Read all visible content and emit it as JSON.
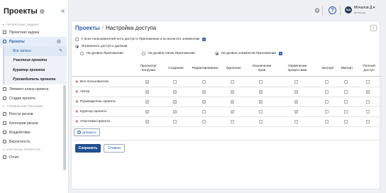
{
  "sidebar": {
    "app_title": "Проекты",
    "sections": [
      {
        "label": "Проектные задачи"
      },
      {
        "label": "Управление рисками"
      },
      {
        "label": "Контроль проектов"
      }
    ],
    "items": {
      "project_task": "Проектная задача",
      "projects": "Проекты",
      "all_records": "Все записи",
      "participant": "Участник проекта",
      "curator": "Куратор проекта",
      "manager": "Руководитель проекта",
      "plan_element": "Элемент плана проекта",
      "stages": "Стадии проекта",
      "risk_registers": "Реестр рисков",
      "risk_categories": "Категории рисков",
      "impact": "Воздействие",
      "probability": "Вероятность",
      "report": "Отчет"
    }
  },
  "topbar": {
    "help": "?",
    "avatar_initials": "МД",
    "user_name": "Мочалов Д",
    "user_sub": "demo-prj"
  },
  "page": {
    "crumb_link": "Проекты",
    "crumb_sep": "/",
    "crumb_current": "Настройка доступа",
    "pin": "⇧",
    "opt_all_users": "У всех пользователей есть доступ к Приложению и ко всем его элементам",
    "opt_restrict": "Ограничить доступ к данным",
    "level_app": "На уровне Приложения",
    "level_folders": "На уровне папок Приложения",
    "level_elements": "На уровне элементов Приложения"
  },
  "table": {
    "headers": [
      "Просмотр/\nЗагрузка",
      "Создание",
      "Редактирование",
      "Удаление",
      "Назначение\nправ",
      "Управление\nпроцессами",
      "Экспорт",
      "Импорт",
      "Полный\nдоступ"
    ],
    "rows": [
      {
        "label": "Все пользователи",
        "checks": [
          true,
          false,
          false,
          false,
          false,
          false,
          false,
          false,
          false
        ]
      },
      {
        "label": "Автор",
        "checks": [
          true,
          true,
          true,
          true,
          true,
          true,
          false,
          false,
          true
        ]
      },
      {
        "label": "Руководитель проекта",
        "checks": [
          true,
          true,
          true,
          true,
          true,
          true,
          false,
          false,
          false
        ]
      },
      {
        "label": "Куратор проекта",
        "checks": [
          true,
          true,
          false,
          true,
          false,
          true,
          false,
          false,
          false
        ]
      },
      {
        "label": "Участники проекта",
        "checks": [
          true,
          false,
          false,
          false,
          false,
          false,
          false,
          false,
          false
        ]
      }
    ]
  },
  "actions": {
    "add": "Добавить",
    "save": "Сохранить",
    "cancel": "Отмена"
  }
}
